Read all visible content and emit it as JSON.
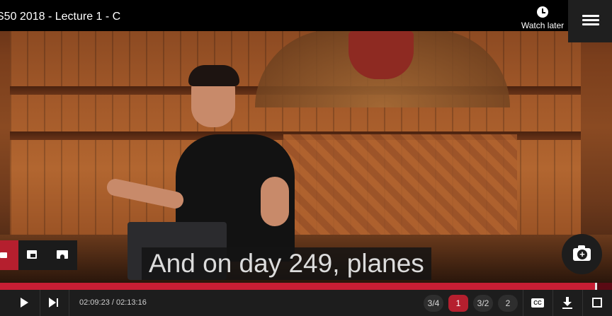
{
  "header": {
    "title": "S50 2018 - Lecture 1 - C",
    "watch_later_label": "Watch later",
    "watch_later_icon": "clock-icon",
    "menu_icon": "playlist-menu-icon"
  },
  "caption": {
    "text": "And on day 249, planes"
  },
  "mini_toolbar": {
    "icons": [
      "video-camera-icon",
      "picture-in-picture-icon",
      "theater-mode-icon"
    ]
  },
  "screenshot_button": {
    "icon": "camera-add-icon"
  },
  "progress": {
    "played_fraction": 0.972,
    "color": "#c81e34",
    "background": "#5a0a14"
  },
  "controls": {
    "time": "02:09:23 / 02:13:16",
    "speeds": [
      "3/4",
      "1",
      "3/2",
      "2"
    ],
    "active_speed": "1",
    "cc_label": "CC",
    "accent": "#b51f2e"
  }
}
